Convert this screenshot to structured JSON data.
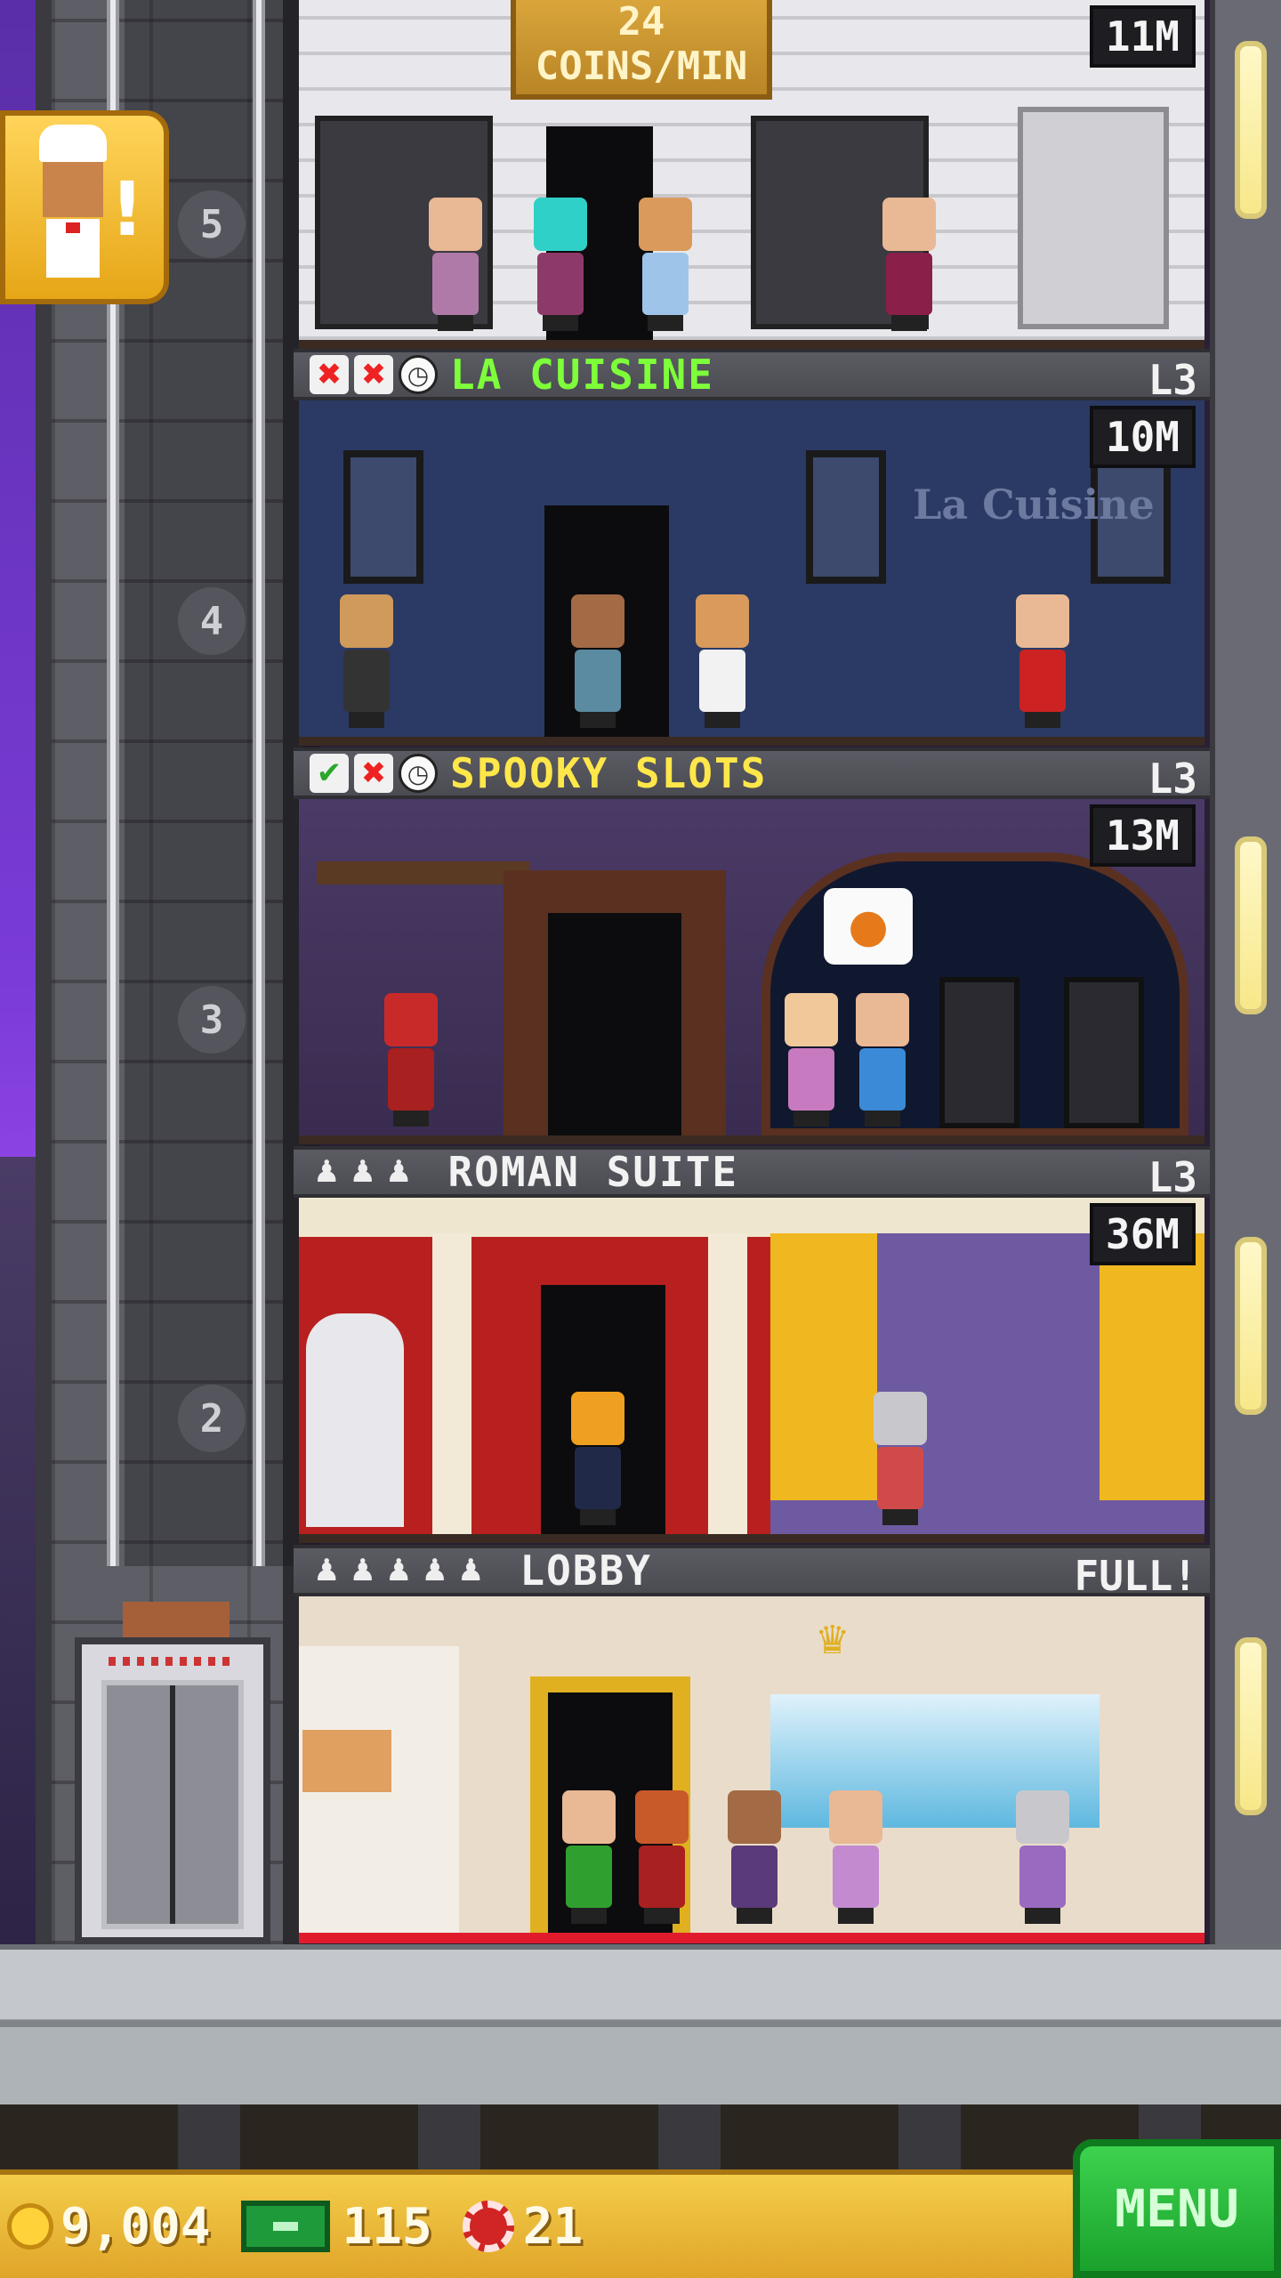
{
  "header": {
    "coins_rate_value": "24",
    "coins_rate_unit": "COINS/MIN"
  },
  "quest": {
    "icon": "chef-icon",
    "mark": "!"
  },
  "shaft": {
    "floor_numbers": [
      "5",
      "4",
      "3",
      "2"
    ]
  },
  "floors": [
    {
      "name": "",
      "level": "",
      "stock": "11M",
      "name_color": "#ffffff"
    },
    {
      "name": "LA CUISINE",
      "level": "L3",
      "stock": "10M",
      "name_color": "#7dff3a",
      "status": [
        "x",
        "x",
        "clock"
      ]
    },
    {
      "name": "SPOOKY SLOTS",
      "level": "L3",
      "stock": "13M",
      "name_color": "#ffe74a",
      "status": [
        "ok",
        "x",
        "clock"
      ]
    },
    {
      "name": "ROMAN SUITE",
      "level": "L3",
      "stock": "36M",
      "name_color": "#f2f2f2",
      "residents": 3
    },
    {
      "name": "LOBBY",
      "level": "FULL!",
      "name_color": "#f2f2f2",
      "residents": 5
    }
  ],
  "room_extras": {
    "la_cuisine_sign": "La Cuisine"
  },
  "hud": {
    "coins": "9,004",
    "bux": "115",
    "tickets": "21",
    "menu_label": "MENU"
  },
  "colors": {
    "accent_green": "#1aa22c",
    "gold": "#e0a52a",
    "label_bar": "#4b4b52"
  }
}
